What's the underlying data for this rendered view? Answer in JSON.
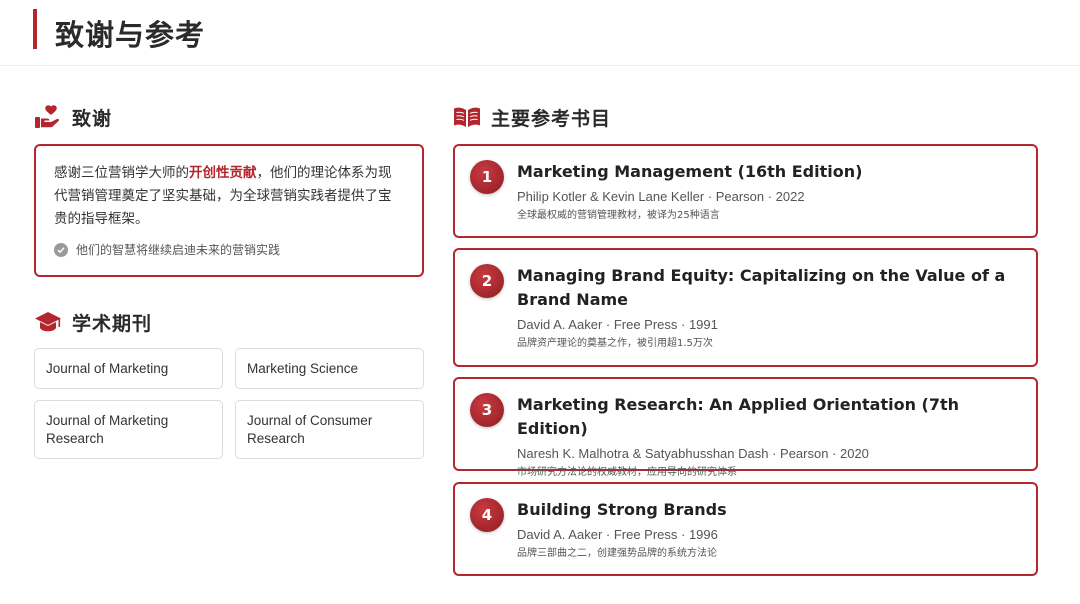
{
  "header": {
    "title": "致谢与参考"
  },
  "acknowledgement": {
    "heading": "致谢",
    "text_before": "感谢三位营销学大师的",
    "highlight": "开创性贡献",
    "text_after": "，他们的理论体系为现代营销管理奠定了坚实基础，为全球营销实践者提供了宝贵的指导框架。",
    "note": "他们的智慧将继续启迪未来的营销实践"
  },
  "journals": {
    "heading": "学术期刊",
    "items": [
      "Journal of Marketing",
      "Marketing Science",
      "Journal of Marketing Research",
      "Journal of Consumer Research"
    ]
  },
  "references": {
    "heading": "主要参考书目",
    "books": [
      {
        "number": "1",
        "title": "Marketing Management (16th Edition)",
        "meta": "Philip Kotler & Kevin Lane Keller · Pearson · 2022",
        "desc": "全球最权威的营销管理教材，被译为25种语言"
      },
      {
        "number": "2",
        "title": "Managing Brand Equity: Capitalizing on the Value of a Brand Name",
        "meta": "David A. Aaker · Free Press · 1991",
        "desc": "品牌资产理论的奠基之作，被引用超1.5万次"
      },
      {
        "number": "3",
        "title": "Marketing Research: An Applied Orientation (7th Edition)",
        "meta": "Naresh K. Malhotra & Satyabhusshan Dash · Pearson · 2020",
        "desc": "市场研究方法论的权威教材，应用导向的研究体系"
      },
      {
        "number": "4",
        "title": "Building Strong Brands",
        "meta": "David A. Aaker · Free Press · 1996",
        "desc": "品牌三部曲之二，创建强势品牌的系统方法论"
      }
    ]
  },
  "colors": {
    "accent": "#b3262d",
    "text": "#222222"
  }
}
